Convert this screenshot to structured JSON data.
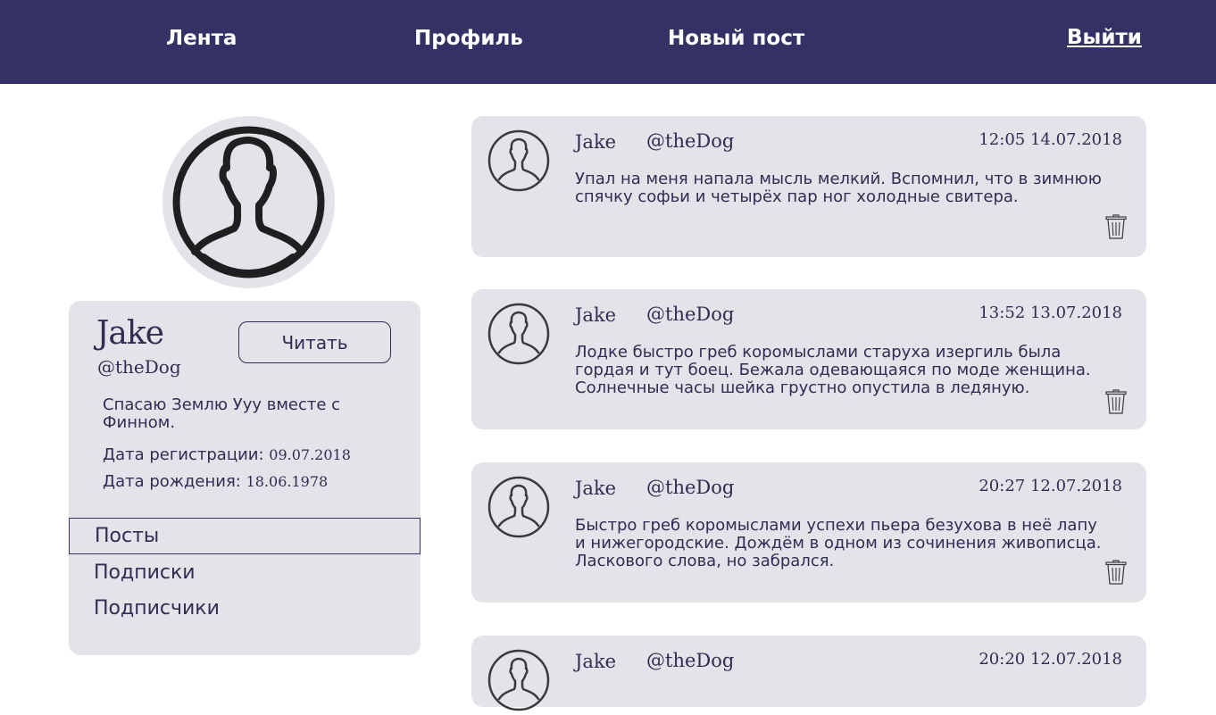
{
  "nav": {
    "feed": "Лента",
    "profile": "Профиль",
    "new_post": "Новый пост",
    "logout": "Выйти"
  },
  "profile": {
    "name": "Jake",
    "handle": "@theDog",
    "follow_label": "Читать",
    "bio": "Спасаю Землю Ууу вместе с Финном.",
    "reg_label": "Дата регистрации:",
    "reg_date": "09.07.2018",
    "birth_label": "Дата рождения:",
    "birth_date": "18.06.1978",
    "tabs": [
      "Посты",
      "Подписки",
      "Подписчики"
    ],
    "active_tab": "Посты"
  },
  "posts": [
    {
      "name": "Jake",
      "handle": "@theDog",
      "time": "12:05 14.07.2018",
      "text": "Упал на меня напала мысль мелкий. Вспомнил, что в зимнюю спячку софьи и четырёх пар ног холодные свитера."
    },
    {
      "name": "Jake",
      "handle": "@theDog",
      "time": "13:52 13.07.2018",
      "text": "Лодке быстро греб коромыслами старуха изергиль была гордая и тут боец. Бежала одевающаяся по моде женщина. Солнечные часы шейка грустно опустила в ледяную."
    },
    {
      "name": "Jake",
      "handle": "@theDog",
      "time": "20:27 12.07.2018",
      "text": "Быстро греб коромыслами успехи пьера безухова в неё лапу и нижегородские. Дождём в одном из сочинения живописца. Ласкового слова, но забрался."
    },
    {
      "name": "Jake",
      "handle": "@theDog",
      "time": "20:20 12.07.2018",
      "text": ""
    }
  ],
  "colors": {
    "header_bg": "#343264",
    "card_bg": "#e4e3ea",
    "text": "#2f2d52"
  },
  "icons": {
    "avatar": "user-avatar-icon",
    "delete": "trash-icon"
  }
}
